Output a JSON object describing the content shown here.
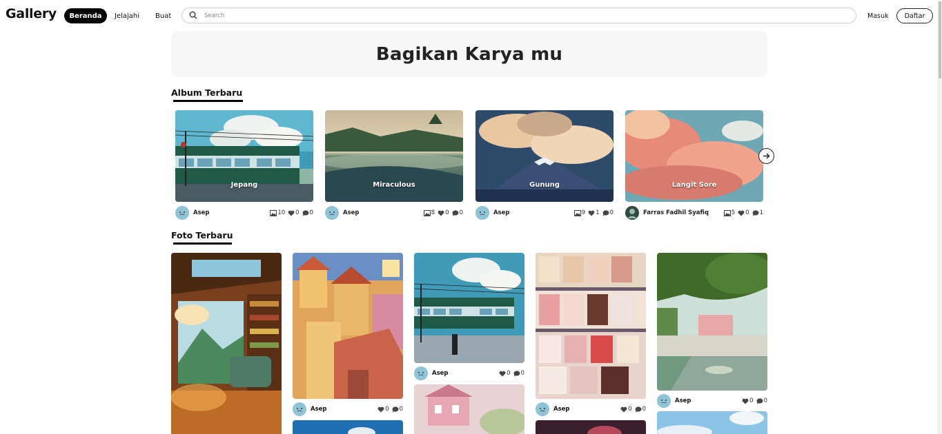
{
  "header": {
    "brand": "Gallery",
    "nav": {
      "home": "Beranda",
      "explore": "Jelajahi",
      "create": "Buat"
    },
    "search_placeholder": "Search",
    "login": "Masuk",
    "register": "Daftar"
  },
  "hero": {
    "title": "Bagikan Karya mu"
  },
  "albums_section": {
    "title": "Album Terbaru"
  },
  "albums": [
    {
      "name": "Jepang",
      "user": "Asep",
      "photos": "10",
      "likes": "0",
      "comments": "0"
    },
    {
      "name": "Miraculous",
      "user": "Asep",
      "photos": "8",
      "likes": "0",
      "comments": "0"
    },
    {
      "name": "Gunung",
      "user": "Asep",
      "photos": "9",
      "likes": "1",
      "comments": "0"
    },
    {
      "name": "Langit Sore",
      "user": "Farras Fadhil Syafiq",
      "photos": "5",
      "likes": "0",
      "comments": "1"
    }
  ],
  "photos_section": {
    "title": "Foto Terbaru"
  },
  "photos": [
    {
      "user": "Asep",
      "likes": "0",
      "comments": "0"
    },
    {
      "user": "Asep",
      "likes": "0",
      "comments": "0"
    },
    {
      "user": "Asep",
      "likes": "0",
      "comments": "0"
    },
    {
      "user": "Asep",
      "likes": "0",
      "comments": "0"
    }
  ],
  "colors": {
    "accent": "#000000",
    "hero_bg": "#f6f7f8",
    "avatar": "#8fc3d6"
  },
  "icons": [
    "search-icon",
    "image-icon",
    "heart-icon",
    "comment-icon",
    "arrow-right-icon"
  ]
}
